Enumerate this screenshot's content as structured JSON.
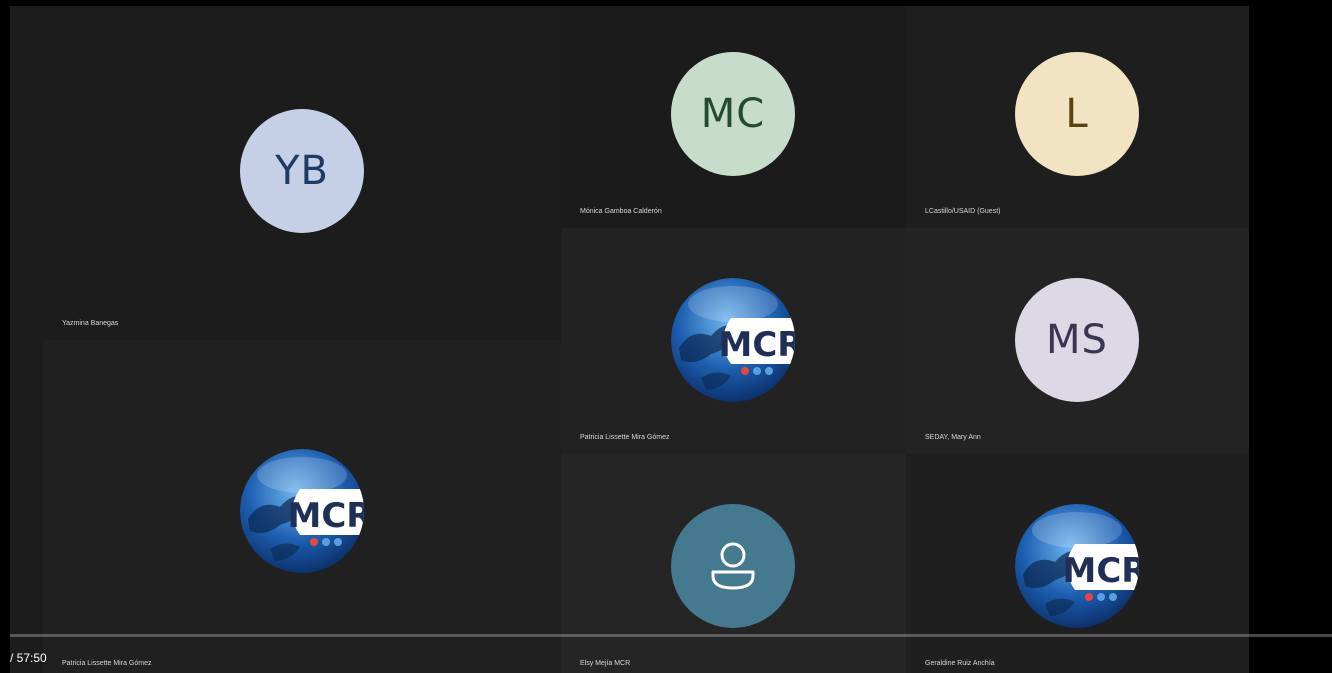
{
  "participants": [
    {
      "name": "Yazmina Banegas",
      "initials": "YB",
      "avatar_type": "initials",
      "avatar_bg": "#c5d0e6",
      "avatar_fg": "#1f3a66"
    },
    {
      "name": "Mónica Gamboa Calderón",
      "initials": "MC",
      "avatar_type": "initials",
      "avatar_bg": "#c8dccb",
      "avatar_fg": "#234a33"
    },
    {
      "name": "LCastillo/USAID (Guest)",
      "initials": "L",
      "avatar_type": "initials",
      "avatar_bg": "#f2e3c2",
      "avatar_fg": "#5b4210"
    },
    {
      "name": "Patricia Lissette Mira Gómez",
      "initials": "",
      "avatar_type": "mcr-logo",
      "logo_text": "MCR"
    },
    {
      "name": "SEDAY, Mary Ann",
      "initials": "MS",
      "avatar_type": "initials",
      "avatar_bg": "#dcd8e6",
      "avatar_fg": "#3b3650"
    },
    {
      "name": "Patricia Lissette Mira Gómez",
      "initials": "",
      "avatar_type": "mcr-logo",
      "logo_text": "MCR"
    },
    {
      "name": "Elsy Mejía MCR",
      "initials": "",
      "avatar_type": "person-icon",
      "icon": "person-icon"
    },
    {
      "name": "Geraldine Ruiz Anchía",
      "initials": "",
      "avatar_type": "mcr-logo",
      "logo_text": "MCR"
    }
  ],
  "player": {
    "time_display": "/ 57:50"
  }
}
